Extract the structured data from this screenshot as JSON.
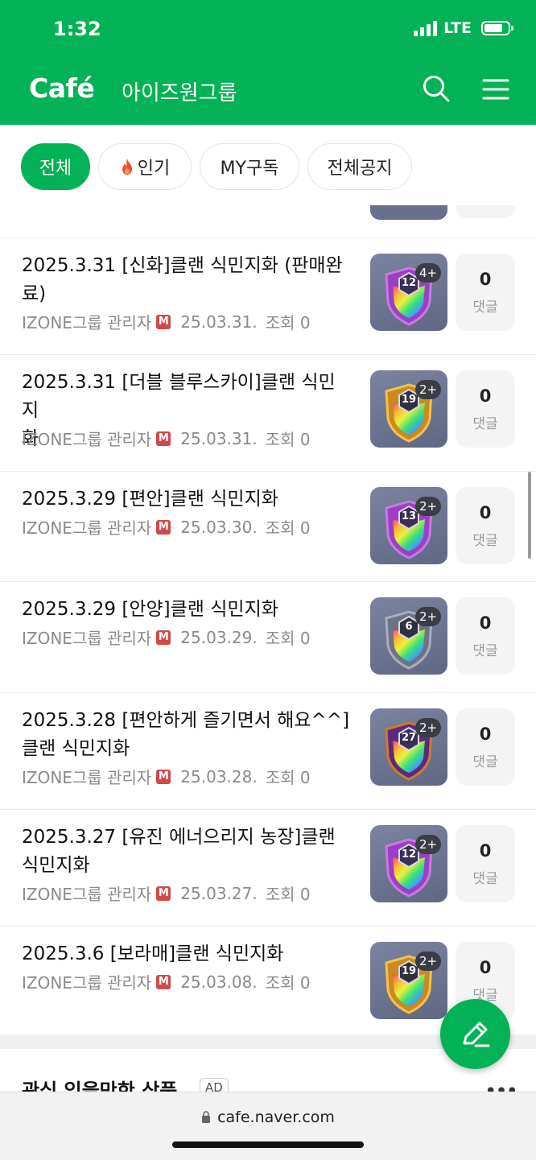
{
  "status": {
    "time": "1:32",
    "network": "LTE"
  },
  "header": {
    "logo": "Café",
    "cafe_name": "아이즈원그룹"
  },
  "tabs": [
    {
      "label": "전체",
      "active": true
    },
    {
      "label": "인기",
      "icon": "fire-icon"
    },
    {
      "label": "MY구독"
    },
    {
      "label": "전체공지"
    }
  ],
  "posts": [
    {
      "title_lines": [
        "2025.3.31 [신화]클랜 식민지화 (판매완",
        "료)"
      ],
      "author": "IZONE그룹 관리자",
      "badge": "M",
      "date": "25.03.31.",
      "views": "조회 0",
      "level": "12",
      "plus": "4+",
      "shield": "purple",
      "comments": "0",
      "comments_label": "댓글"
    },
    {
      "title_lines": [
        "2025.3.31 [더블 블루스카이]클랜 식민지",
        "화"
      ],
      "author": "IZONE그룹 관리자",
      "badge": "M",
      "date": "25.03.31.",
      "views": "조회 0",
      "level": "19",
      "plus": "2+",
      "shield": "gold",
      "comments": "0",
      "comments_label": "댓글"
    },
    {
      "title_lines": [
        "2025.3.29 [편안]클랜 식민지화"
      ],
      "author": "IZONE그룹 관리자",
      "badge": "M",
      "date": "25.03.30.",
      "views": "조회 0",
      "level": "13",
      "plus": "2+",
      "shield": "purple",
      "comments": "0",
      "comments_label": "댓글"
    },
    {
      "title_lines": [
        "2025.3.29 [안양]클랜 식민지화"
      ],
      "author": "IZONE그룹 관리자",
      "badge": "M",
      "date": "25.03.29.",
      "views": "조회 0",
      "level": "6",
      "plus": "2+",
      "shield": "silver",
      "comments": "0",
      "comments_label": "댓글"
    },
    {
      "title_lines": [
        "2025.3.28 [편안하게 즐기면서 해요^^]",
        "클랜 식민지화"
      ],
      "author": "IZONE그룹 관리자",
      "badge": "M",
      "date": "25.03.28.",
      "views": "조회 0",
      "level": "27",
      "plus": "2+",
      "shield": "dark",
      "comments": "0",
      "comments_label": "댓글"
    },
    {
      "title_lines": [
        "2025.3.27 [유진 에너으리지 농장]클랜",
        "식민지화"
      ],
      "author": "IZONE그룹 관리자",
      "badge": "M",
      "date": "25.03.27.",
      "views": "조회 0",
      "level": "12",
      "plus": "2+",
      "shield": "purple",
      "comments": "0",
      "comments_label": "댓글"
    },
    {
      "title_lines": [
        "2025.3.6 [보라매]클랜 식민지화"
      ],
      "author": "IZONE그룹 관리자",
      "badge": "M",
      "date": "25.03.08.",
      "views": "조회 0",
      "level": "19",
      "plus": "2+",
      "shield": "gold",
      "comments": "0",
      "comments_label": "댓글"
    }
  ],
  "ad": {
    "title": "관심 있을만한 상품",
    "tag": "AD",
    "more": "•••"
  },
  "browser": {
    "url": "cafe.naver.com"
  },
  "colors": {
    "brand": "#03b256",
    "badge": "#d04848"
  }
}
